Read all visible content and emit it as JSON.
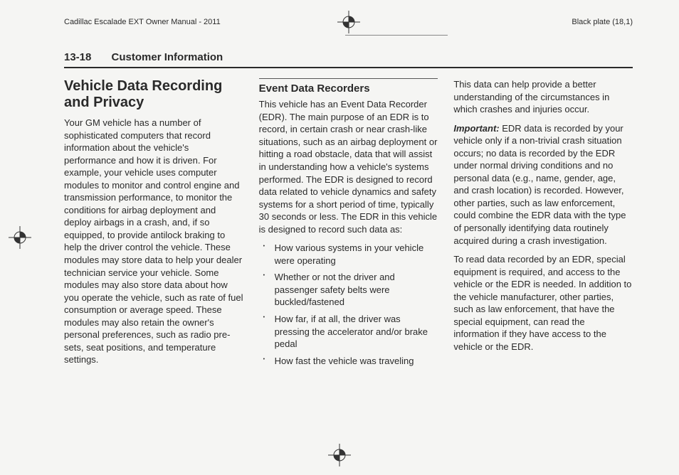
{
  "header": {
    "manual_title": "Cadillac Escalade EXT Owner Manual - 2011",
    "plate_info": "Black plate (18,1)"
  },
  "chapter": {
    "page_number": "13-18",
    "title": "Customer Information"
  },
  "col1": {
    "heading": "Vehicle Data Recording and Privacy",
    "para1": "Your GM vehicle has a number of sophisticated computers that record information about the vehicle's performance and how it is driven. For example, your vehicle uses computer modules to monitor and control engine and transmission performance, to monitor the conditions for airbag deployment and deploy airbags in a crash, and, if so equipped, to provide antilock braking to help the driver control the vehicle. These modules may store data to help your dealer technician service your vehicle. Some modules may also store data about how you operate the vehicle, such as rate of fuel consumption or average speed. These modules may also retain the owner's personal preferences, such as radio pre-sets, seat positions, and temperature settings."
  },
  "col2": {
    "heading": "Event Data Recorders",
    "para1": "This vehicle has an Event Data Recorder (EDR). The main purpose of an EDR is to record, in certain crash or near crash-like situations, such as an airbag deployment or hitting a road obstacle, data that will assist in understanding how a vehicle's systems performed. The EDR is designed to record data related to vehicle dynamics and safety systems for a short period of time, typically 30 seconds or less. The EDR in this vehicle is designed to record such data as:",
    "bullets": [
      "How various systems in your vehicle were operating",
      "Whether or not the driver and passenger safety belts were buckled/fastened",
      "How far, if at all, the driver was pressing the accelerator and/or brake pedal",
      "How fast the vehicle was traveling"
    ]
  },
  "col3": {
    "para1": "This data can help provide a better understanding of the circumstances in which crashes and injuries occur.",
    "important_label": "Important:",
    "important_text": " EDR data is recorded by your vehicle only if a non-trivial crash situation occurs; no data is recorded by the EDR under normal driving conditions and no personal data (e.g., name, gender, age, and crash location) is recorded. However, other parties, such as law enforcement, could combine the EDR data with the type of personally identifying data routinely acquired during a crash investigation.",
    "para3": "To read data recorded by an EDR, special equipment is required, and access to the vehicle or the EDR is needed. In addition to the vehicle manufacturer, other parties, such as law enforcement, that have the special equipment, can read the information if they have access to the vehicle or the EDR."
  }
}
